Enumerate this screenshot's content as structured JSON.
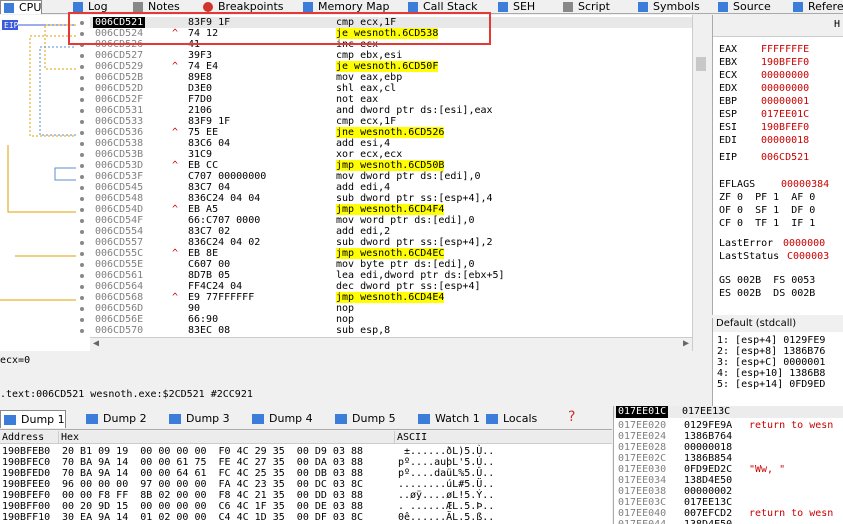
{
  "top_tabs": [
    {
      "label": "CPU",
      "icon": "cpu-icon",
      "active": true
    },
    {
      "label": "Log",
      "icon": "log-icon"
    },
    {
      "label": "Notes",
      "icon": "notes-icon"
    },
    {
      "label": "Breakpoints",
      "icon": "breakpoint-icon"
    },
    {
      "label": "Memory Map",
      "icon": "memory-map-icon"
    },
    {
      "label": "Call Stack",
      "icon": "call-stack-icon"
    },
    {
      "label": "SEH",
      "icon": "seh-icon"
    },
    {
      "label": "Script",
      "icon": "script-icon"
    },
    {
      "label": "Symbols",
      "icon": "symbols-icon"
    },
    {
      "label": "Source",
      "icon": "source-icon"
    },
    {
      "label": "Refere",
      "icon": "references-icon"
    }
  ],
  "eip_label": "EIP",
  "disasm": [
    {
      "addr": "006CD521",
      "mark": "",
      "bytes": "83F9 1F",
      "ins": "cmp ecx,1F",
      "sel": true
    },
    {
      "addr": "006CD524",
      "mark": "^",
      "bytes": "74 12",
      "ins": "je wesnoth.6CD538",
      "jmp": true
    },
    {
      "addr": "006CD526",
      "mark": "",
      "bytes": "41",
      "ins": "inc ecx"
    },
    {
      "addr": "006CD527",
      "mark": "",
      "bytes": "39F3",
      "ins": "cmp ebx,esi"
    },
    {
      "addr": "006CD529",
      "mark": "^",
      "bytes": "74 E4",
      "ins": "je wesnoth.6CD50F",
      "jmp": true
    },
    {
      "addr": "006CD52B",
      "mark": "",
      "bytes": "89E8",
      "ins": "mov eax,ebp"
    },
    {
      "addr": "006CD52D",
      "mark": "",
      "bytes": "D3E0",
      "ins": "shl eax,cl"
    },
    {
      "addr": "006CD52F",
      "mark": "",
      "bytes": "F7D0",
      "ins": "not eax"
    },
    {
      "addr": "006CD531",
      "mark": "",
      "bytes": "2106",
      "ins": "and dword ptr ds:[esi],eax"
    },
    {
      "addr": "006CD533",
      "mark": "",
      "bytes": "83F9 1F",
      "ins": "cmp ecx,1F"
    },
    {
      "addr": "006CD536",
      "mark": "^",
      "bytes": "75 EE",
      "ins": "jne wesnoth.6CD526",
      "jmp": true
    },
    {
      "addr": "006CD538",
      "mark": "",
      "bytes": "83C6 04",
      "ins": "add esi,4"
    },
    {
      "addr": "006CD53B",
      "mark": "",
      "bytes": "31C9",
      "ins": "xor ecx,ecx"
    },
    {
      "addr": "006CD53D",
      "mark": "^",
      "bytes": "EB CC",
      "ins": "jmp wesnoth.6CD50B",
      "jmp": true
    },
    {
      "addr": "006CD53F",
      "mark": "",
      "bytes": "C707 00000000",
      "ins": "mov dword ptr ds:[edi],0"
    },
    {
      "addr": "006CD545",
      "mark": "",
      "bytes": "83C7 04",
      "ins": "add edi,4"
    },
    {
      "addr": "006CD548",
      "mark": "",
      "bytes": "836C24 04 04",
      "ins": "sub dword ptr ss:[esp+4],4"
    },
    {
      "addr": "006CD54D",
      "mark": "^",
      "bytes": "EB A5",
      "ins": "jmp wesnoth.6CD4F4",
      "jmp": true
    },
    {
      "addr": "006CD54F",
      "mark": "",
      "bytes": "66:C707 0000",
      "ins": "mov word ptr ds:[edi],0"
    },
    {
      "addr": "006CD554",
      "mark": "",
      "bytes": "83C7 02",
      "ins": "add edi,2"
    },
    {
      "addr": "006CD557",
      "mark": "",
      "bytes": "836C24 04 02",
      "ins": "sub dword ptr ss:[esp+4],2"
    },
    {
      "addr": "006CD55C",
      "mark": "^",
      "bytes": "EB 8E",
      "ins": "jmp wesnoth.6CD4EC",
      "jmp": true
    },
    {
      "addr": "006CD55E",
      "mark": "",
      "bytes": "C607 00",
      "ins": "mov byte ptr ds:[edi],0"
    },
    {
      "addr": "006CD561",
      "mark": "",
      "bytes": "8D7B 05",
      "ins": "lea edi,dword ptr ds:[ebx+5]"
    },
    {
      "addr": "006CD564",
      "mark": "",
      "bytes": "FF4C24 04",
      "ins": "dec dword ptr ss:[esp+4]"
    },
    {
      "addr": "006CD568",
      "mark": "^",
      "bytes": "E9 77FFFFFF",
      "ins": "jmp wesnoth.6CD4E4",
      "jmp": true
    },
    {
      "addr": "006CD56D",
      "mark": "",
      "bytes": "90",
      "ins": "nop"
    },
    {
      "addr": "006CD56E",
      "mark": "",
      "bytes": "66:90",
      "ins": "nop"
    },
    {
      "addr": "006CD570",
      "mark": "",
      "bytes": "83EC 08",
      "ins": "sub esp,8"
    }
  ],
  "registers": {
    "header": "H",
    "gp": [
      {
        "name": "EAX",
        "val": "FFFFFFFE"
      },
      {
        "name": "EBX",
        "val": "190BFEF0"
      },
      {
        "name": "ECX",
        "val": "00000000"
      },
      {
        "name": "EDX",
        "val": "00000000"
      },
      {
        "name": "EBP",
        "val": "00000001"
      },
      {
        "name": "ESP",
        "val": "017EE01C"
      },
      {
        "name": "ESI",
        "val": "190BFEF0"
      },
      {
        "name": "EDI",
        "val": "00000018"
      }
    ],
    "eip": {
      "name": "EIP",
      "val": "006CD521"
    },
    "eflags": {
      "name": "EFLAGS",
      "val": "00000384"
    },
    "flags": [
      "ZF 0  PF 1  AF 0",
      "OF 0  SF 1  DF 0",
      "CF 0  TF 1  IF 1"
    ],
    "last_error": {
      "name": "LastError",
      "val": "0000000"
    },
    "last_status": {
      "name": "LastStatus",
      "val": "C000003"
    },
    "segs": [
      "GS 002B  FS 0053",
      "ES 002B  DS 002B"
    ]
  },
  "info": {
    "line1": "ecx=0",
    "line2": ".text:006CD521 wesnoth.exe:$2CD521 #2CC921"
  },
  "callconv": {
    "title": "Default (stdcall)",
    "rows": [
      "1: [esp+4] 0129FE9",
      "2: [esp+8] 1386B76",
      "3: [esp+C] 0000001",
      "4: [esp+10] 1386B8",
      "5: [esp+14] 0FD9ED"
    ]
  },
  "dump_tabs": [
    {
      "label": "Dump 1",
      "active": true
    },
    {
      "label": "Dump 2"
    },
    {
      "label": "Dump 3"
    },
    {
      "label": "Dump 4"
    },
    {
      "label": "Dump 5"
    },
    {
      "label": "Watch 1"
    },
    {
      "label": "Locals"
    }
  ],
  "dump": {
    "headers": {
      "addr": "Address",
      "hex": "Hex",
      "ascii": "ASCII"
    },
    "rows": [
      {
        "addr": "190BFEB0",
        "hex": "20 B1 09 19  00 00 00 00  F0 4C 29 35  00 D9 03 88",
        "ascii": " ±......ðL)5.Ù.."
      },
      {
        "addr": "190BFEC0",
        "hex": "70 BA 9A 14  00 00 61 75  FE 4C 27 35  00 DA 03 88",
        "ascii": "pº....auþL'5.Ú.."
      },
      {
        "addr": "190BFED0",
        "hex": "70 BA 9A 14  00 00 64 61  FC 4C 25 35  00 DB 03 88",
        "ascii": "pº....daüL%5.Û.."
      },
      {
        "addr": "190BFEE0",
        "hex": "96 00 00 00  97 00 00 00  FA 4C 23 35  00 DC 03 8C",
        "ascii": "........úL#5.Ü.."
      },
      {
        "addr": "190BFEF0",
        "hex": "00 00 F8 FF  8B 02 00 00  F8 4C 21 35  00 DD 03 88",
        "ascii": "..øÿ....øL!5.Ý.."
      },
      {
        "addr": "190BFF00",
        "hex": "00 20 9D 15  00 00 00 00  C6 4C 1F 35  00 DE 03 88",
        "ascii": ". ......ÆL.5.Þ.."
      },
      {
        "addr": "190BFF10",
        "hex": "30 EA 9A 14  01 02 00 00  C4 4C 1D 35  00 DF 03 8C",
        "ascii": "0ê......ÄL.5.ß.."
      }
    ]
  },
  "stack": {
    "head_addr": "017EE01C",
    "head_val": "017EE13C",
    "rows": [
      {
        "addr": "017EE020",
        "val": "0129FE9A",
        "comment": "return to wesn"
      },
      {
        "addr": "017EE024",
        "val": "1386B764",
        "comment": ""
      },
      {
        "addr": "017EE028",
        "val": "00000018",
        "comment": ""
      },
      {
        "addr": "017EE02C",
        "val": "1386B854",
        "comment": ""
      },
      {
        "addr": "017EE030",
        "val": "0FD9ED2C",
        "comment": "\"Ww, \""
      },
      {
        "addr": "017EE034",
        "val": "138D4E50",
        "comment": ""
      },
      {
        "addr": "017EE038",
        "val": "00000002",
        "comment": ""
      },
      {
        "addr": "017EE03C",
        "val": "017EE13C",
        "comment": ""
      },
      {
        "addr": "017EE040",
        "val": "007EFCD2",
        "comment": "return to wesn"
      },
      {
        "addr": "017EE044",
        "val": "138D4E50",
        "comment": ""
      }
    ]
  },
  "colors": {
    "highlight_box": "#e53935",
    "jump": "#ffff00",
    "register": "#cc0000"
  }
}
